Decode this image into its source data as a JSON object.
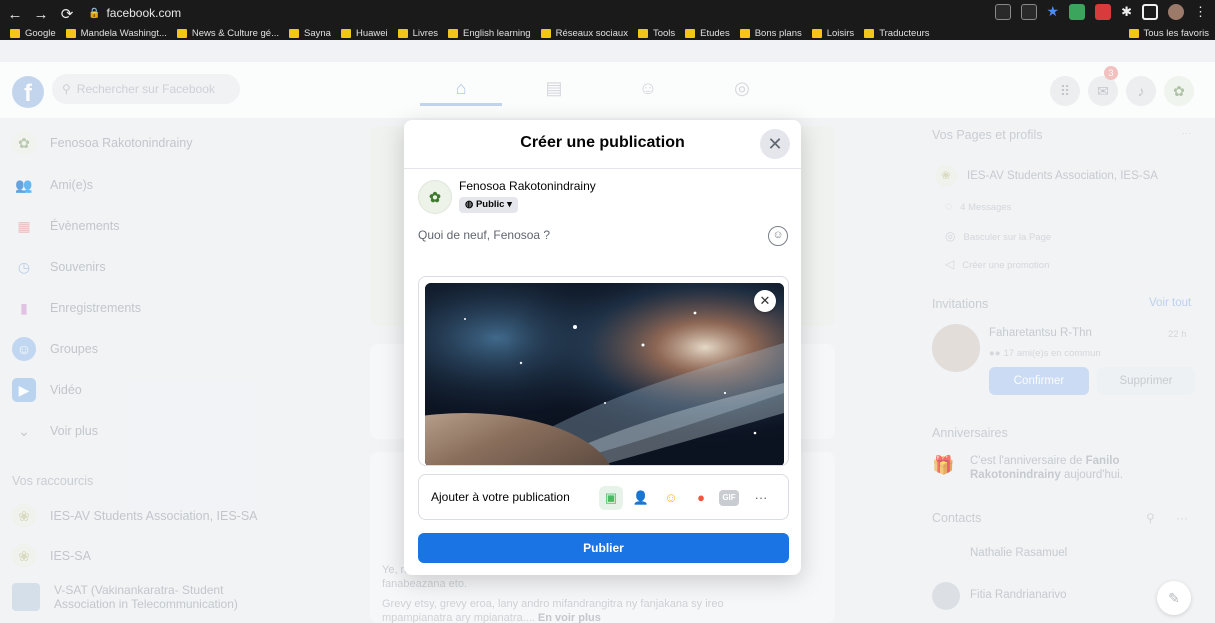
{
  "browser": {
    "url": "facebook.com",
    "bookmarks": [
      "Google",
      "Mandela Washingt...",
      "News & Culture gé...",
      "Sayna",
      "Huawei",
      "Livres",
      "English learning",
      "Réseaux sociaux",
      "Tools",
      "Etudes",
      "Bons plans",
      "Loisirs",
      "Traducteurs"
    ],
    "all_bookmarks": "Tous les favoris"
  },
  "header": {
    "search_placeholder": "Rechercher sur Facebook",
    "notification_count": "3"
  },
  "left_sidebar": {
    "profile_name": "Fenosoa Rakotonindrainy",
    "items": [
      "Ami(e)s",
      "Évènements",
      "Souvenirs",
      "Enregistrements",
      "Groupes",
      "Vidéo",
      "Voir plus"
    ],
    "shortcuts_title": "Vos raccourcis",
    "shortcuts": [
      "IES-AV Students Association, IES-SA",
      "IES-SA",
      "V-SAT (Vakinankaratra- Student",
      "Association in Telecommunication)"
    ]
  },
  "feed": {
    "post_text_1": "Ye, n",
    "post_text_2": "fanabeazana eto.",
    "post_text_3": "Grevy etsy, grevy eroa, lany andro mifandrangitra ny fanjakana sy ireo",
    "post_text_4": "mpampianatra ary mpianatra....",
    "see_more": "En voir plus"
  },
  "right_sidebar": {
    "pages_title": "Vos Pages et profils",
    "page_name": "IES-AV Students Association, IES-SA",
    "messages": "4 Messages",
    "switch_page": "Basculer sur la Page",
    "create_promo": "Créer une promotion",
    "invitations_title": "Invitations",
    "see_all": "Voir tout",
    "inviter_name": "Faharetantsu R-Thn",
    "inviter_time": "22 h",
    "mutual": "17 ami(e)s en commun",
    "confirm": "Confirmer",
    "delete": "Supprimer",
    "birthdays_title": "Anniversaires",
    "birthday_prefix": "C'est l'anniversaire de",
    "birthday_name_1": "Fanilo",
    "birthday_name_2": "Rakotonindrainy",
    "birthday_suffix": "aujourd'hui.",
    "contacts_title": "Contacts",
    "contacts": [
      "Nathalie Rasamuel",
      "Fitia Randrianarivo"
    ]
  },
  "modal": {
    "title": "Créer une publication",
    "author": "Fenosoa Rakotonindrainy",
    "audience": "Public",
    "composer_placeholder": "Quoi de neuf, Fenosoa ?",
    "add_to_post": "Ajouter à votre publication",
    "gif_label": "GIF",
    "publish": "Publier"
  },
  "colors": {
    "fb_blue": "#1b74e4",
    "chrome_dark": "#1a1a1a",
    "bookmark_folder": "#f5c518"
  }
}
